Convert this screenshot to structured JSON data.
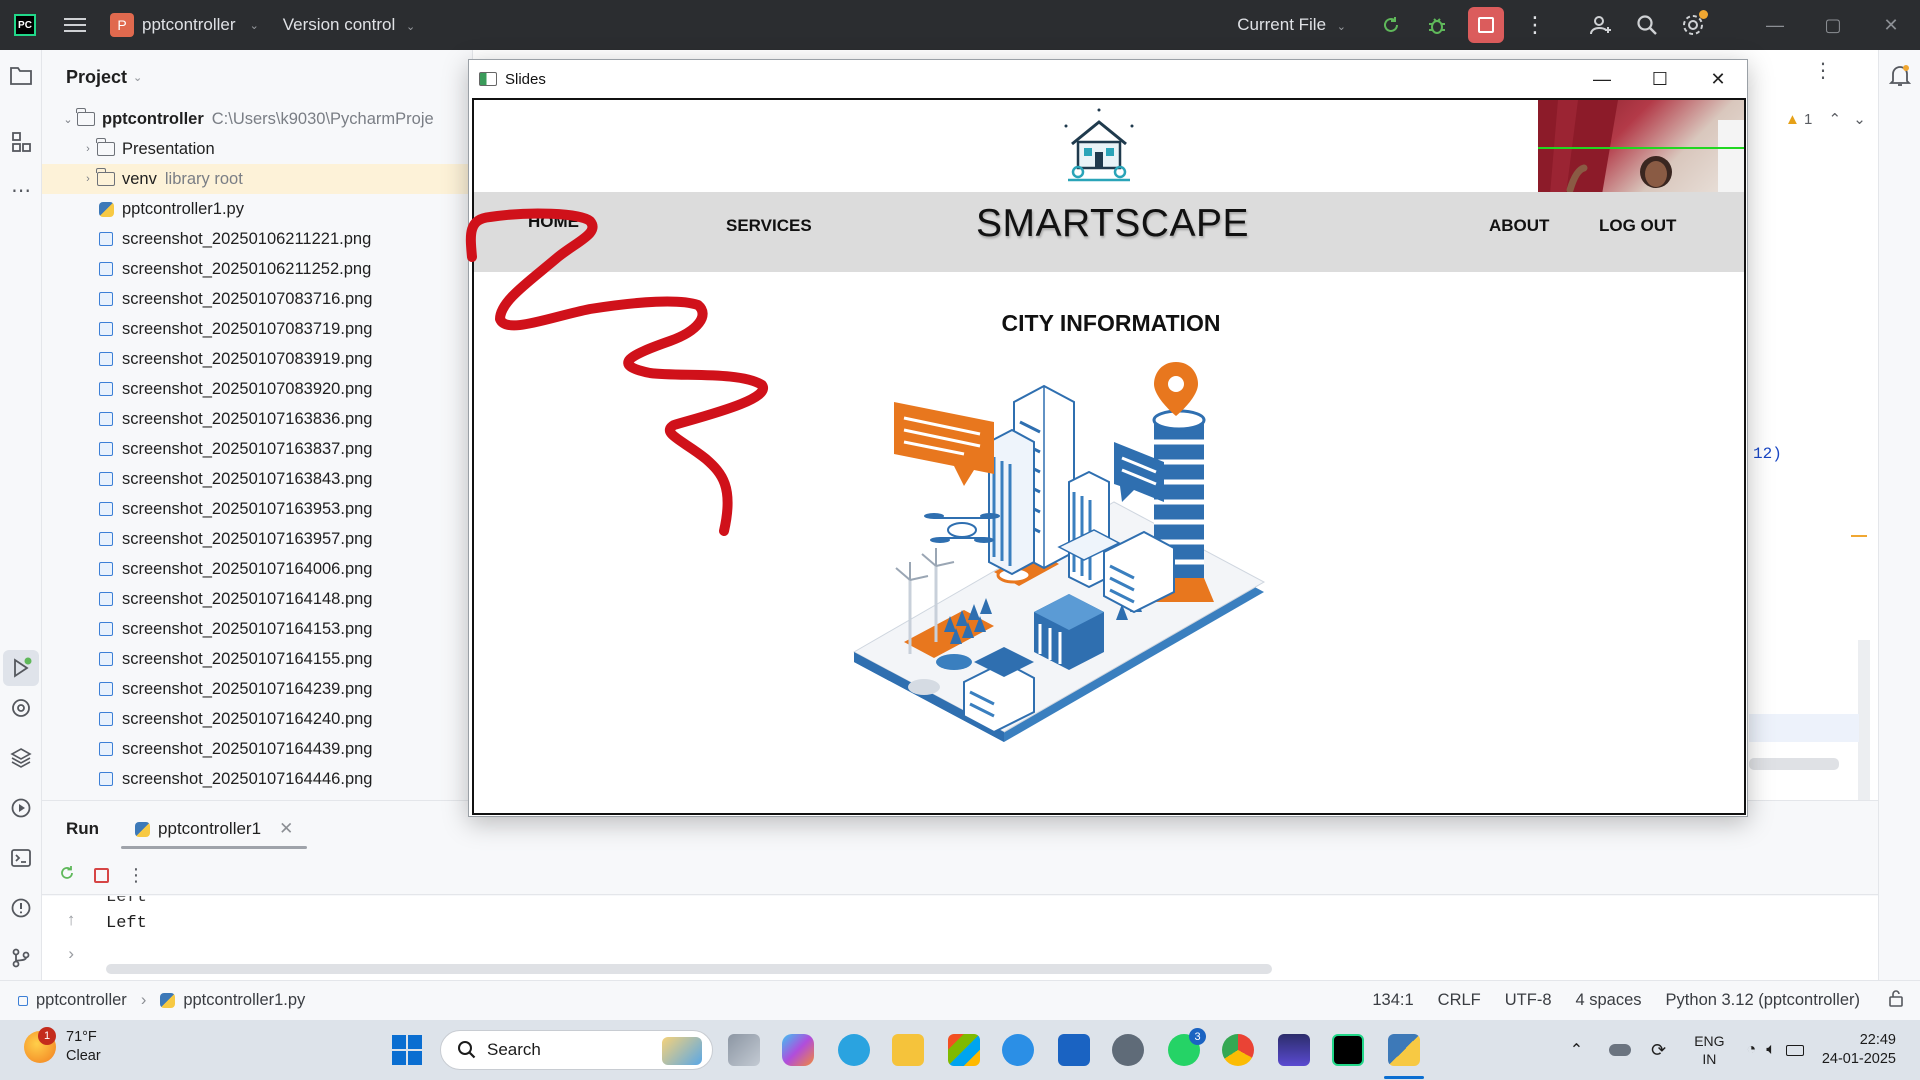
{
  "ide": {
    "project_name": "pptcontroller",
    "project_badge": "P",
    "version_control": "Version control",
    "run_config": "Current File"
  },
  "project_panel": {
    "title": "Project",
    "root": {
      "name": "pptcontroller",
      "path": "C:\\Users\\k9030\\PycharmProje"
    },
    "items": [
      {
        "label": "Presentation",
        "kind": "folder",
        "note": ""
      },
      {
        "label": "venv",
        "kind": "folder",
        "note": "library root"
      },
      {
        "label": "pptcontroller1.py",
        "kind": "python"
      },
      {
        "label": "screenshot_20250106211221.png"
      },
      {
        "label": "screenshot_20250106211252.png"
      },
      {
        "label": "screenshot_20250107083716.png"
      },
      {
        "label": "screenshot_20250107083719.png"
      },
      {
        "label": "screenshot_20250107083919.png"
      },
      {
        "label": "screenshot_20250107083920.png"
      },
      {
        "label": "screenshot_20250107163836.png"
      },
      {
        "label": "screenshot_20250107163837.png"
      },
      {
        "label": "screenshot_20250107163843.png"
      },
      {
        "label": "screenshot_20250107163953.png"
      },
      {
        "label": "screenshot_20250107163957.png"
      },
      {
        "label": "screenshot_20250107164006.png"
      },
      {
        "label": "screenshot_20250107164148.png"
      },
      {
        "label": "screenshot_20250107164153.png"
      },
      {
        "label": "screenshot_20250107164155.png"
      },
      {
        "label": "screenshot_20250107164239.png"
      },
      {
        "label": "screenshot_20250107164240.png"
      },
      {
        "label": "screenshot_20250107164439.png"
      },
      {
        "label": "screenshot_20250107164446.png"
      }
    ]
  },
  "editor": {
    "warning_count": "1",
    "code_fragment": "12)"
  },
  "run_panel": {
    "title": "Run",
    "tab_label": "pptcontroller1",
    "console_lines": [
      "Left",
      "Left"
    ]
  },
  "status_bar": {
    "breadcrumb_project": "pptcontroller",
    "breadcrumb_file": "pptcontroller1.py",
    "position": "134:1",
    "line_ending": "CRLF",
    "encoding": "UTF-8",
    "indent": "4 spaces",
    "interpreter": "Python 3.12 (pptcontroller)"
  },
  "slides_window": {
    "title": "Slides",
    "slide": {
      "nav": [
        "HOME",
        "SERVICES",
        "ABOUT",
        "LOG OUT"
      ],
      "brand": "SMARTSCAPE",
      "heading": "CITY INFORMATION"
    }
  },
  "taskbar": {
    "weather_temp": "71°F",
    "weather_cond": "Clear",
    "weather_badge": "1",
    "search_placeholder": "Search",
    "whatsapp_badge": "3",
    "lang_top": "ENG",
    "lang_bottom": "IN",
    "time": "22:49",
    "date": "24-01-2025"
  },
  "colors": {
    "accent_stop": "#db5c5c",
    "ink_stroke": "#d0111a",
    "city_orange": "#e8771e",
    "city_blue": "#2f6fb0"
  }
}
